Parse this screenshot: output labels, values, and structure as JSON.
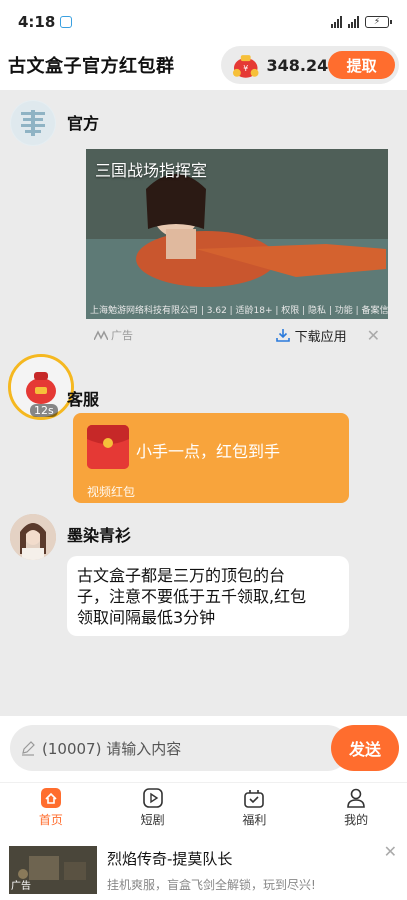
{
  "status_bar": {
    "time": "4:18",
    "battery": ""
  },
  "header": {
    "title": "古文盒子官方红包群",
    "balance": "348.24",
    "withdraw_label": "提取"
  },
  "messages": [
    {
      "sender": "官方",
      "type": "ad",
      "ad": {
        "image_title": "三国战场指挥室",
        "image_footer": "上海勉游网络科技有限公司 | 3.62 | 适龄18+ | 权限 | 隐私 | 功能 | 备案信息",
        "ad_label": "广告",
        "download_label": "下载应用"
      }
    },
    {
      "sender": "客服",
      "type": "red_packet",
      "timer": "12s",
      "packet_text": "小手一点，红包到手",
      "packet_sub": "视频红包"
    },
    {
      "sender": "墨染青衫",
      "type": "text",
      "lines": [
        "古文盒子都是三万的顶包的台",
        "子，注意不要低于五千领取,红包",
        "领取间隔最低3分钟"
      ]
    }
  ],
  "input": {
    "placeholder": "(10007) 请输入内容",
    "send_label": "发送"
  },
  "tabs": [
    {
      "label": "首页",
      "icon": "home-icon",
      "active": true
    },
    {
      "label": "短剧",
      "icon": "play-icon",
      "active": false
    },
    {
      "label": "福利",
      "icon": "gift-icon",
      "active": false
    },
    {
      "label": "我的",
      "icon": "profile-icon",
      "active": false
    }
  ],
  "bottom_ad": {
    "title": "烈焰传奇-提莫队长",
    "desc": "挂机爽服，盲盒飞剑全解锁，玩到尽兴!",
    "tag": "广告"
  },
  "colors": {
    "accent": "#ff6d2e",
    "packet_bubble": "#f8a43c",
    "packet_red": "#e53935"
  }
}
